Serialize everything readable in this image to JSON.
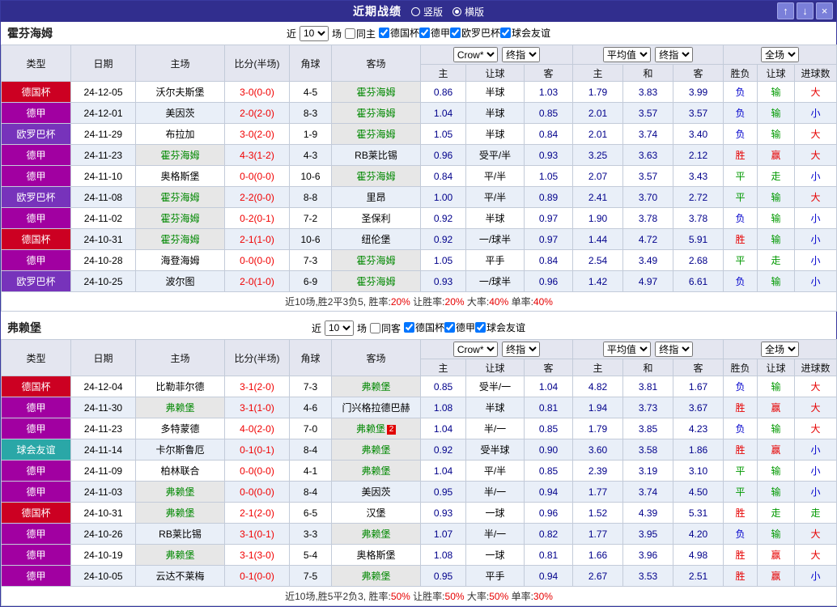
{
  "titlebar": {
    "title": "近期战绩",
    "layout_options": [
      {
        "label": "竖版",
        "selected": false
      },
      {
        "label": "横版",
        "selected": true
      }
    ],
    "icons": {
      "up": "↑",
      "down": "↓",
      "close": "×"
    }
  },
  "table_headers": {
    "type": "类型",
    "date": "日期",
    "home": "主场",
    "score": "比分(半场)",
    "corner": "角球",
    "away": "客场",
    "sub_home": "主",
    "sub_handicap": "让球",
    "sub_away": "客",
    "sub_avg_home": "主",
    "sub_avg_draw": "和",
    "sub_avg_away": "客",
    "sub_result": "胜负",
    "sub_result_handicap": "让球",
    "sub_result_goals": "进球数",
    "bookmaker": "Crow*",
    "final_odds": "终指",
    "average": "平均值",
    "final_odds2": "终指",
    "full_match": "全场"
  },
  "type_colors": {
    "德国杯": "#cc0022",
    "德甲": "#a100a1",
    "欧罗巴杯": "#7733bb",
    "球会友谊": "#2aa7a7"
  },
  "result_colors": {
    "胜": "#e60000",
    "平": "#009900",
    "负": "#0000cc",
    "赢": "#e60000",
    "走": "#009900",
    "输": "#009900",
    "大": "#e60000",
    "小": "#0000cc"
  },
  "sections": [
    {
      "team": "霍芬海姆",
      "filters": {
        "near": "近",
        "count": "10",
        "games": "场",
        "same": {
          "label": "同主",
          "checked": false
        },
        "leagues": [
          {
            "label": "德国杯",
            "checked": true
          },
          {
            "label": "德甲",
            "checked": true
          },
          {
            "label": "欧罗巴杯",
            "checked": true
          },
          {
            "label": "球会友谊",
            "checked": true
          }
        ]
      },
      "rows": [
        {
          "type": "德国杯",
          "date": "24-12-05",
          "home": "沃尔夫斯堡",
          "score": "3-0(0-0)",
          "corner": "4-5",
          "away": "霍芬海姆",
          "subject": "away",
          "odds": [
            "0.86",
            "半球",
            "1.03",
            "1.79",
            "3.83",
            "3.99"
          ],
          "results": [
            "负",
            "输",
            "大"
          ]
        },
        {
          "type": "德甲",
          "date": "24-12-01",
          "home": "美因茨",
          "score": "2-0(2-0)",
          "corner": "8-3",
          "away": "霍芬海姆",
          "subject": "away",
          "odds": [
            "1.04",
            "半球",
            "0.85",
            "2.01",
            "3.57",
            "3.57"
          ],
          "results": [
            "负",
            "输",
            "小"
          ]
        },
        {
          "type": "欧罗巴杯",
          "date": "24-11-29",
          "home": "布拉加",
          "score": "3-0(2-0)",
          "corner": "1-9",
          "away": "霍芬海姆",
          "subject": "away",
          "odds": [
            "1.05",
            "半球",
            "0.84",
            "2.01",
            "3.74",
            "3.40"
          ],
          "results": [
            "负",
            "输",
            "大"
          ]
        },
        {
          "type": "德甲",
          "date": "24-11-23",
          "home": "霍芬海姆",
          "score": "4-3(1-2)",
          "corner": "4-3",
          "away": "RB莱比锡",
          "subject": "home",
          "odds": [
            "0.96",
            "受平/半",
            "0.93",
            "3.25",
            "3.63",
            "2.12"
          ],
          "results": [
            "胜",
            "赢",
            "大"
          ]
        },
        {
          "type": "德甲",
          "date": "24-11-10",
          "home": "奥格斯堡",
          "score": "0-0(0-0)",
          "corner": "10-6",
          "away": "霍芬海姆",
          "subject": "away",
          "odds": [
            "0.84",
            "平/半",
            "1.05",
            "2.07",
            "3.57",
            "3.43"
          ],
          "results": [
            "平",
            "走",
            "小"
          ]
        },
        {
          "type": "欧罗巴杯",
          "date": "24-11-08",
          "home": "霍芬海姆",
          "score": "2-2(0-0)",
          "corner": "8-8",
          "away": "里昂",
          "subject": "home",
          "odds": [
            "1.00",
            "平/半",
            "0.89",
            "2.41",
            "3.70",
            "2.72"
          ],
          "results": [
            "平",
            "输",
            "大"
          ]
        },
        {
          "type": "德甲",
          "date": "24-11-02",
          "home": "霍芬海姆",
          "score": "0-2(0-1)",
          "corner": "7-2",
          "away": "圣保利",
          "subject": "home",
          "odds": [
            "0.92",
            "半球",
            "0.97",
            "1.90",
            "3.78",
            "3.78"
          ],
          "results": [
            "负",
            "输",
            "小"
          ]
        },
        {
          "type": "德国杯",
          "date": "24-10-31",
          "home": "霍芬海姆",
          "score": "2-1(1-0)",
          "corner": "10-6",
          "away": "纽伦堡",
          "subject": "home",
          "odds": [
            "0.92",
            "一/球半",
            "0.97",
            "1.44",
            "4.72",
            "5.91"
          ],
          "results": [
            "胜",
            "输",
            "小"
          ]
        },
        {
          "type": "德甲",
          "date": "24-10-28",
          "home": "海登海姆",
          "score": "0-0(0-0)",
          "corner": "7-3",
          "away": "霍芬海姆",
          "subject": "away",
          "odds": [
            "1.05",
            "平手",
            "0.84",
            "2.54",
            "3.49",
            "2.68"
          ],
          "results": [
            "平",
            "走",
            "小"
          ]
        },
        {
          "type": "欧罗巴杯",
          "date": "24-10-25",
          "home": "波尔图",
          "score": "2-0(1-0)",
          "corner": "6-9",
          "away": "霍芬海姆",
          "subject": "away",
          "odds": [
            "0.93",
            "一/球半",
            "0.96",
            "1.42",
            "4.97",
            "6.61"
          ],
          "results": [
            "负",
            "输",
            "小"
          ]
        }
      ],
      "summary": [
        {
          "text": "近10场,胜2平3负5, 胜率:",
          "color": "#333333"
        },
        {
          "text": "20%",
          "color": "#e60000"
        },
        {
          "text": " 让胜率:",
          "color": "#333333"
        },
        {
          "text": "20%",
          "color": "#e60000"
        },
        {
          "text": " 大率:",
          "color": "#333333"
        },
        {
          "text": "40%",
          "color": "#e60000"
        },
        {
          "text": " 单率:",
          "color": "#333333"
        },
        {
          "text": "40%",
          "color": "#e60000"
        }
      ]
    },
    {
      "team": "弗赖堡",
      "filters": {
        "near": "近",
        "count": "10",
        "games": "场",
        "same": {
          "label": "同客",
          "checked": false
        },
        "leagues": [
          {
            "label": "德国杯",
            "checked": true
          },
          {
            "label": "德甲",
            "checked": true
          },
          {
            "label": "球会友谊",
            "checked": true
          }
        ]
      },
      "rows": [
        {
          "type": "德国杯",
          "date": "24-12-04",
          "home": "比勒菲尔德",
          "score": "3-1(2-0)",
          "corner": "7-3",
          "away": "弗赖堡",
          "subject": "away",
          "odds": [
            "0.85",
            "受半/一",
            "1.04",
            "4.82",
            "3.81",
            "1.67"
          ],
          "results": [
            "负",
            "输",
            "大"
          ]
        },
        {
          "type": "德甲",
          "date": "24-11-30",
          "home": "弗赖堡",
          "score": "3-1(1-0)",
          "corner": "4-6",
          "away": "门兴格拉德巴赫",
          "subject": "home",
          "odds": [
            "1.08",
            "半球",
            "0.81",
            "1.94",
            "3.73",
            "3.67"
          ],
          "results": [
            "胜",
            "赢",
            "大"
          ]
        },
        {
          "type": "德甲",
          "date": "24-11-23",
          "home": "多特蒙德",
          "score": "4-0(2-0)",
          "corner": "7-0",
          "away": "弗赖堡",
          "subject": "away",
          "away_badge": "2",
          "odds": [
            "1.04",
            "半/一",
            "0.85",
            "1.79",
            "3.85",
            "4.23"
          ],
          "results": [
            "负",
            "输",
            "大"
          ]
        },
        {
          "type": "球会友谊",
          "date": "24-11-14",
          "home": "卡尔斯鲁厄",
          "score": "0-1(0-1)",
          "corner": "8-4",
          "away": "弗赖堡",
          "subject": "away",
          "odds": [
            "0.92",
            "受半球",
            "0.90",
            "3.60",
            "3.58",
            "1.86"
          ],
          "results": [
            "胜",
            "赢",
            "小"
          ]
        },
        {
          "type": "德甲",
          "date": "24-11-09",
          "home": "柏林联合",
          "score": "0-0(0-0)",
          "corner": "4-1",
          "away": "弗赖堡",
          "subject": "away",
          "odds": [
            "1.04",
            "平/半",
            "0.85",
            "2.39",
            "3.19",
            "3.10"
          ],
          "results": [
            "平",
            "输",
            "小"
          ]
        },
        {
          "type": "德甲",
          "date": "24-11-03",
          "home": "弗赖堡",
          "score": "0-0(0-0)",
          "corner": "8-4",
          "away": "美因茨",
          "subject": "home",
          "odds": [
            "0.95",
            "半/一",
            "0.94",
            "1.77",
            "3.74",
            "4.50"
          ],
          "results": [
            "平",
            "输",
            "小"
          ]
        },
        {
          "type": "德国杯",
          "date": "24-10-31",
          "home": "弗赖堡",
          "score": "2-1(2-0)",
          "corner": "6-5",
          "away": "汉堡",
          "subject": "home",
          "odds": [
            "0.93",
            "一球",
            "0.96",
            "1.52",
            "4.39",
            "5.31"
          ],
          "results": [
            "胜",
            "走",
            "走"
          ]
        },
        {
          "type": "德甲",
          "date": "24-10-26",
          "home": "RB莱比锡",
          "score": "3-1(0-1)",
          "corner": "3-3",
          "away": "弗赖堡",
          "subject": "away",
          "odds": [
            "1.07",
            "半/一",
            "0.82",
            "1.77",
            "3.95",
            "4.20"
          ],
          "results": [
            "负",
            "输",
            "大"
          ]
        },
        {
          "type": "德甲",
          "date": "24-10-19",
          "home": "弗赖堡",
          "score": "3-1(3-0)",
          "corner": "5-4",
          "away": "奥格斯堡",
          "subject": "home",
          "odds": [
            "1.08",
            "一球",
            "0.81",
            "1.66",
            "3.96",
            "4.98"
          ],
          "results": [
            "胜",
            "赢",
            "大"
          ]
        },
        {
          "type": "德甲",
          "date": "24-10-05",
          "home": "云达不莱梅",
          "score": "0-1(0-0)",
          "corner": "7-5",
          "away": "弗赖堡",
          "subject": "away",
          "odds": [
            "0.95",
            "平手",
            "0.94",
            "2.67",
            "3.53",
            "2.51"
          ],
          "results": [
            "胜",
            "赢",
            "小"
          ]
        }
      ],
      "summary": [
        {
          "text": "近10场,胜5平2负3, 胜率:",
          "color": "#333333"
        },
        {
          "text": "50%",
          "color": "#e60000"
        },
        {
          "text": " 让胜率:",
          "color": "#333333"
        },
        {
          "text": "50%",
          "color": "#e60000"
        },
        {
          "text": " 大率:",
          "color": "#333333"
        },
        {
          "text": "50%",
          "color": "#e60000"
        },
        {
          "text": " 单率:",
          "color": "#333333"
        },
        {
          "text": "30%",
          "color": "#e60000"
        }
      ]
    }
  ]
}
